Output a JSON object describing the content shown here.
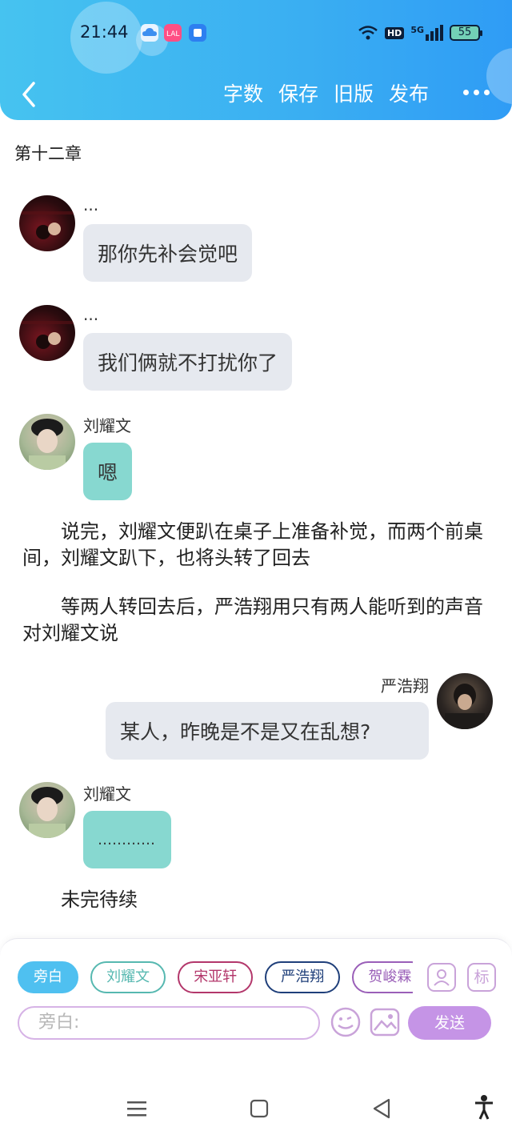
{
  "status_bar": {
    "time": "21:44",
    "battery": "55",
    "network": "5G",
    "hd": "HD"
  },
  "header": {
    "actions": [
      "字数",
      "保存",
      "旧版",
      "发布"
    ]
  },
  "chapter_title": "第十二章",
  "messages": [
    {
      "name": "...",
      "text": "那你先补会觉吧"
    },
    {
      "name": "...",
      "text": "我们俩就不打扰你了"
    },
    {
      "name": "刘耀文",
      "text": "嗯"
    },
    {
      "name": "严浩翔",
      "text": "某人，昨晚是不是又在乱想?"
    },
    {
      "name": "刘耀文",
      "text": "…………"
    }
  ],
  "paragraphs": [
    "说完，刘耀文便趴在桌子上准备补觉，而两个前桌间，刘耀文趴下，也将头转了回去",
    "等两人转回去后，严浩翔用只有两人能听到的声音对刘耀文说",
    "未完待续"
  ],
  "composer": {
    "chips": [
      {
        "label": "旁白",
        "color": "#3fb8ef"
      },
      {
        "label": "刘耀文",
        "color": "#56b8b0"
      },
      {
        "label": "宋亚轩",
        "color": "#b3376b"
      },
      {
        "label": "严浩翔",
        "color": "#1f3f7a"
      },
      {
        "label": "贺峻霖",
        "color": "#9a5fb8"
      }
    ],
    "mark_button": "标",
    "input_placeholder": "旁白:",
    "send_label": "发送"
  },
  "icons": [
    "back-arrow-icon",
    "more-icon",
    "add-role-icon",
    "emoji-icon",
    "image-icon",
    "menu-icon",
    "home-icon",
    "back-icon",
    "accessibility-icon"
  ]
}
